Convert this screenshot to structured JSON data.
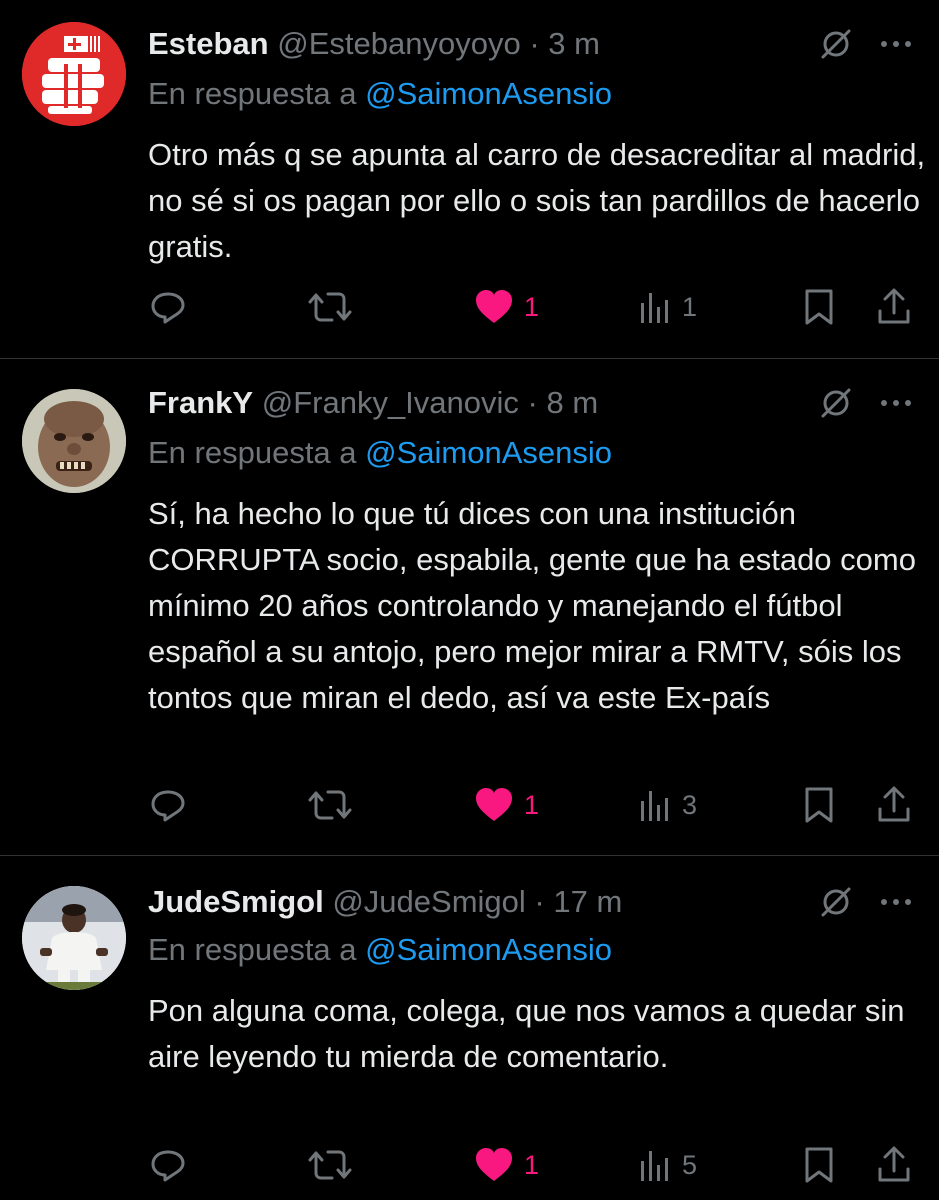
{
  "theme": {
    "background": "#000000",
    "text": "#e7e9ea",
    "muted": "#71767b",
    "link": "#1d9bf0",
    "like": "#f91880",
    "divider": "#2f3336"
  },
  "tweets": [
    {
      "display_name": "Esteban",
      "handle": "@Estebanyoyoyo",
      "separator": "·",
      "time": "3 m",
      "reply_prefix": "En respuesta a",
      "reply_to": "@SaimonAsensio",
      "text": "Otro más q se apunta al carro de desacreditar al madrid, no sé si os pagan por ello o sois tan pardillos de hacerlo gratis.",
      "avatar_icon": "crest-logo-icon",
      "likes": "1",
      "views": "1",
      "liked": true
    },
    {
      "display_name": "FrankY",
      "handle": "@Franky_Ivanovic",
      "separator": "·",
      "time": "8 m",
      "reply_prefix": "En respuesta a",
      "reply_to": "@SaimonAsensio",
      "text": "Sí, ha hecho lo que tú dices con una institución CORRUPTA socio, espabila, gente que ha estado como mínimo 20 años controlando y manejando el fútbol español a su antojo, pero mejor mirar a RMTV, sóis los tontos que miran el dedo, así va este Ex-país",
      "avatar_icon": "face-photo",
      "likes": "1",
      "views": "3",
      "liked": true
    },
    {
      "display_name": "JudeSmigol",
      "handle": "@JudeSmigol",
      "separator": "·",
      "time": "17 m",
      "reply_prefix": "En respuesta a",
      "reply_to": "@SaimonAsensio",
      "text": "Pon alguna coma, colega, que nos vamos a quedar sin aire leyendo tu mierda de comentario.",
      "avatar_icon": "player-photo",
      "likes": "1",
      "views": "5",
      "liked": true
    }
  ],
  "icons": {
    "mute": "mute-icon",
    "more": "more-icon",
    "reply": "reply-icon",
    "retweet": "retweet-icon",
    "like": "heart-icon",
    "views": "views-icon",
    "bookmark": "bookmark-icon",
    "share": "share-icon"
  }
}
